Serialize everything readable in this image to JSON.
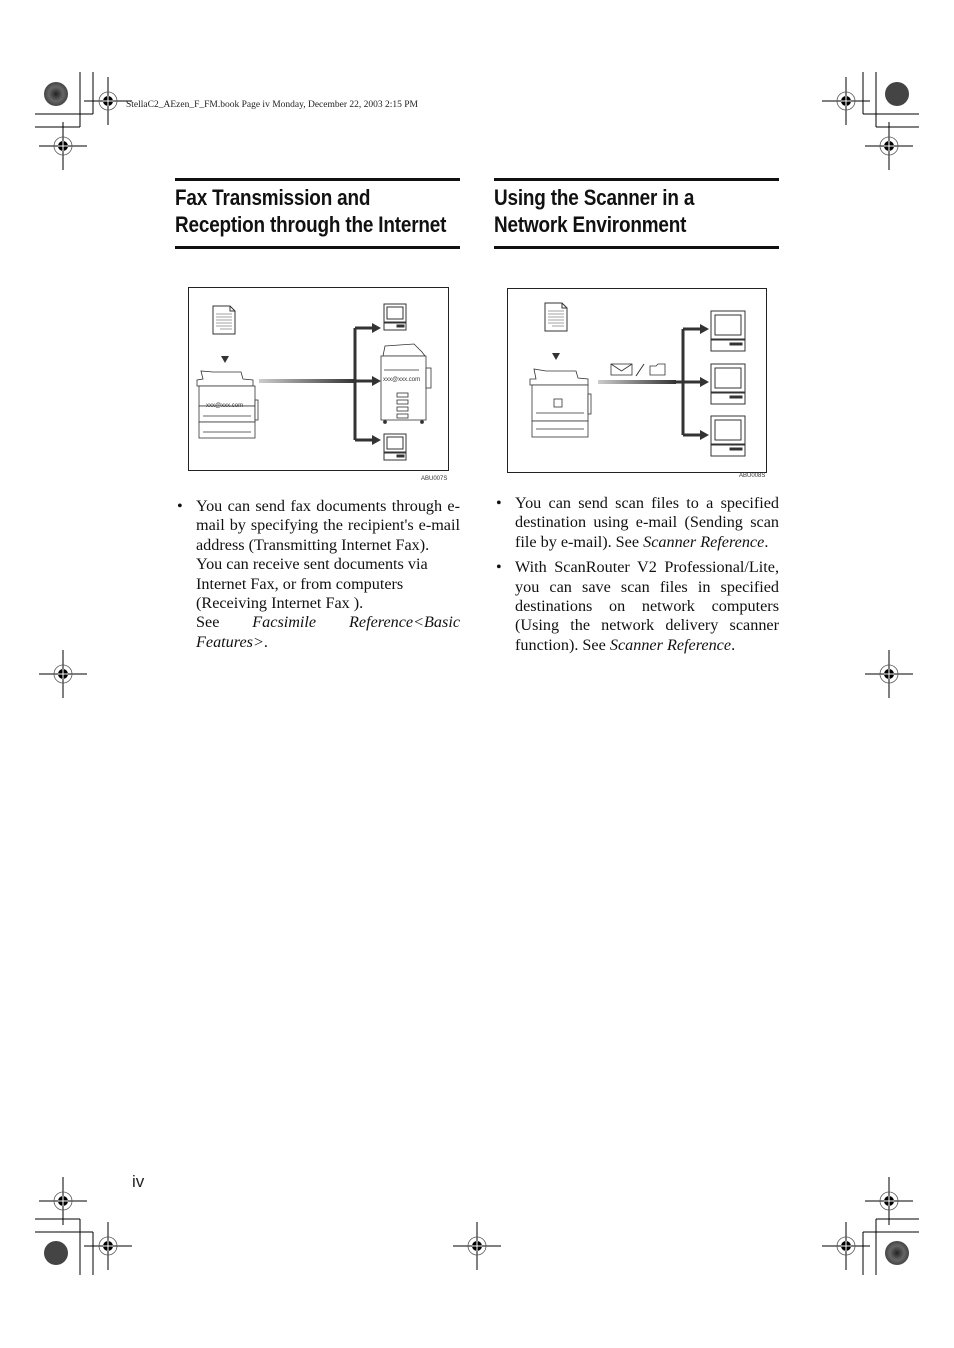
{
  "header": {
    "print_info": "StellaC2_AEzen_F_FM.book  Page iv  Monday, December 22, 2003  2:15 PM"
  },
  "sections": [
    {
      "title_line1": "Fax Transmission and",
      "title_line2": "Reception through the Internet",
      "figure": {
        "id_label": "ABU007S",
        "email_label_sender": "xxx@xxx.com",
        "email_label_receiver": "xxx@xxx.com",
        "icons": [
          "document-icon",
          "mfp-sender-icon",
          "computer-icon",
          "mfp-receiver-icon",
          "computer-icon"
        ]
      },
      "bullets": [
        {
          "paragraphs": [
            {
              "text": "You can send fax documents through e-mail by specifying the recipient's e-mail address (Transmitting Internet Fax)."
            },
            {
              "text": "You can receive sent documents via Internet Fax, or from computers (Receiving Internet Fax )."
            },
            {
              "prefix": "See ",
              "ref": "Facsimile Reference<Basic Features>",
              "suffix": "."
            }
          ]
        }
      ]
    },
    {
      "title_line1": "Using the Scanner in a",
      "title_line2": "Network Environment",
      "figure": {
        "id_label": "ABU008S",
        "icons": [
          "document-icon",
          "scanner-mfp-icon",
          "envelope-icon",
          "folder-icon",
          "computer-icon",
          "computer-icon",
          "computer-icon"
        ]
      },
      "bullets": [
        {
          "paragraphs": [
            {
              "prefix": "You can send scan files to a specified destination using e-mail (Sending scan file by e-mail). See ",
              "ref": "Scanner Reference",
              "suffix": "."
            }
          ]
        },
        {
          "paragraphs": [
            {
              "prefix": "With ScanRouter V2 Professional/Lite, you can save scan files in specified destinations on network computers (Using the network delivery scanner function). See ",
              "ref": "Scanner Reference",
              "suffix": "."
            }
          ]
        }
      ]
    }
  ],
  "footer": {
    "page_number": "iv"
  }
}
